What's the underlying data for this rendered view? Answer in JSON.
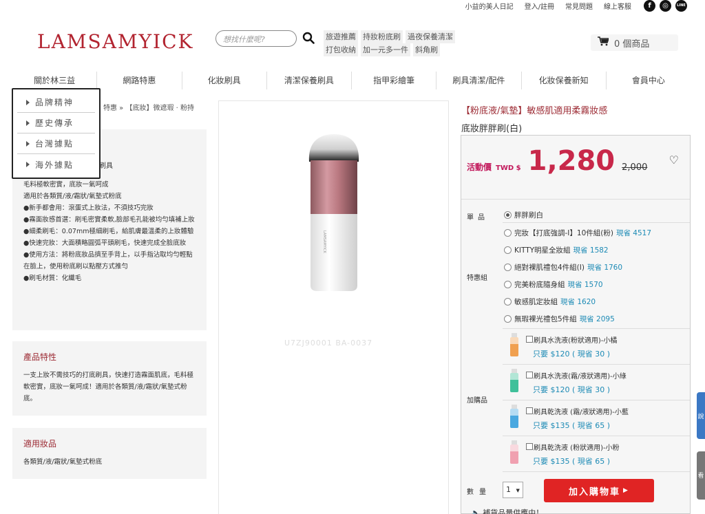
{
  "toplinks": [
    "小益的美人日記",
    "登入/註冊",
    "常見問題",
    "線上客服"
  ],
  "social": [
    "f",
    "◎",
    "LINE"
  ],
  "logo": "LAMSAMYICK",
  "search": {
    "placeholder": "想找什麼呢?"
  },
  "hotwords": [
    "旅遊推薦",
    "持妝粉底刷",
    "過夜保養清潔",
    "打包收納",
    "加一元多一件",
    "斜角刷"
  ],
  "cart": {
    "label": "0 個商品"
  },
  "nav": [
    "關於林三益",
    "網路特惠",
    "化妝刷具",
    "清潔保養刷具",
    "指甲彩繪筆",
    "刷具清潔/配件",
    "化妝保養新知",
    "會員中心"
  ],
  "dropdown": [
    "品牌精神",
    "歷史傳承",
    "台灣據點",
    "海外據點"
  ],
  "breadcrumb": "特惠 » 【底妝】微遮瑕 · 粉持",
  "panel1": {
    "title_fragment": "刷具",
    "body": "毛料極軟密實，底妝一氣呵成\n適用於各類質/液/霜狀/氣墊式粉底\n●新手都會用：滾蛋式上妝法，不須技巧完妝\n●霧面妝感首選：刷毛密實柔軟,臉部毛孔能被均勻填補上妝\n●細柔刷毛：0.07mm極細刷毛，給肌膚最溫柔的上妝體驗\n●快速完妝：大面積略圓弧平頭刷毛，快速完成全臉底妝\n●使用方法：將粉底妝品擠至手背上，以手指沾取均勻輕點在臉上，使用粉底刷以點壓方式推勻\n●刷毛材質：化纖毛"
  },
  "panel2": {
    "title": "產品特性",
    "body": "一支上妝不需技巧的打底刷具，快速打造霧面肌底，毛料極軟密實，底妝一氣呵成！適用於各類質/液/霜狀/氣墊式粉底。"
  },
  "panel3": {
    "title": "適用妝品",
    "body": "各類質/液/霜狀/氣墊式粉底"
  },
  "product": {
    "sku": "U7ZJ90001 BA-0037",
    "category": "【粉底液/氣墊】敏感肌適用柔霧妝感",
    "name": "底妝胖胖刷(白)",
    "promo_label": "活動價",
    "currency": "TWD $",
    "price": "1,280",
    "original_price": "2,000"
  },
  "options": {
    "single_label": "單品",
    "single": "胖胖刷白",
    "bundle_label": "特惠組",
    "bundles": [
      {
        "name": "完妝【打底強調-I】10件組(粉)",
        "save": "現省 4517"
      },
      {
        "name": "KITTY明星全妝組",
        "save": "現省 1582"
      },
      {
        "name": "絕對裸肌禮包4件組(I)",
        "save": "現省 1760"
      },
      {
        "name": "完美粉底隨身組",
        "save": "現省 1570"
      },
      {
        "name": "敏感肌定妝組",
        "save": "現省 1620"
      },
      {
        "name": "無瑕裸光禮包5件組",
        "save": "現省 2095"
      }
    ],
    "addon_label": "加購品",
    "addons": [
      {
        "name": "刷具水洗液(粉狀適用)-小橘",
        "price": "只要 $120 ( 現省 30 )",
        "color": "#f0a050"
      },
      {
        "name": "刷具水洗液(霜/液狀適用)-小綠",
        "price": "只要 $120 ( 現省 30 )",
        "color": "#40c09a"
      },
      {
        "name": "刷具乾洗液 (霜/液狀適用)-小藍",
        "price": "只要 $135 ( 現省 65 )",
        "color": "#4aa8e0"
      },
      {
        "name": "刷具乾洗液 (粉狀適用)-小粉",
        "price": "只要 $135 ( 現省 65 )",
        "color": "#f0a0b0"
      }
    ]
  },
  "qty": {
    "label": "數量",
    "value": "1"
  },
  "add_to_cart": "加入購物車",
  "stock": "補貨品量供應中！",
  "side_tabs": [
    "說",
    "看"
  ]
}
